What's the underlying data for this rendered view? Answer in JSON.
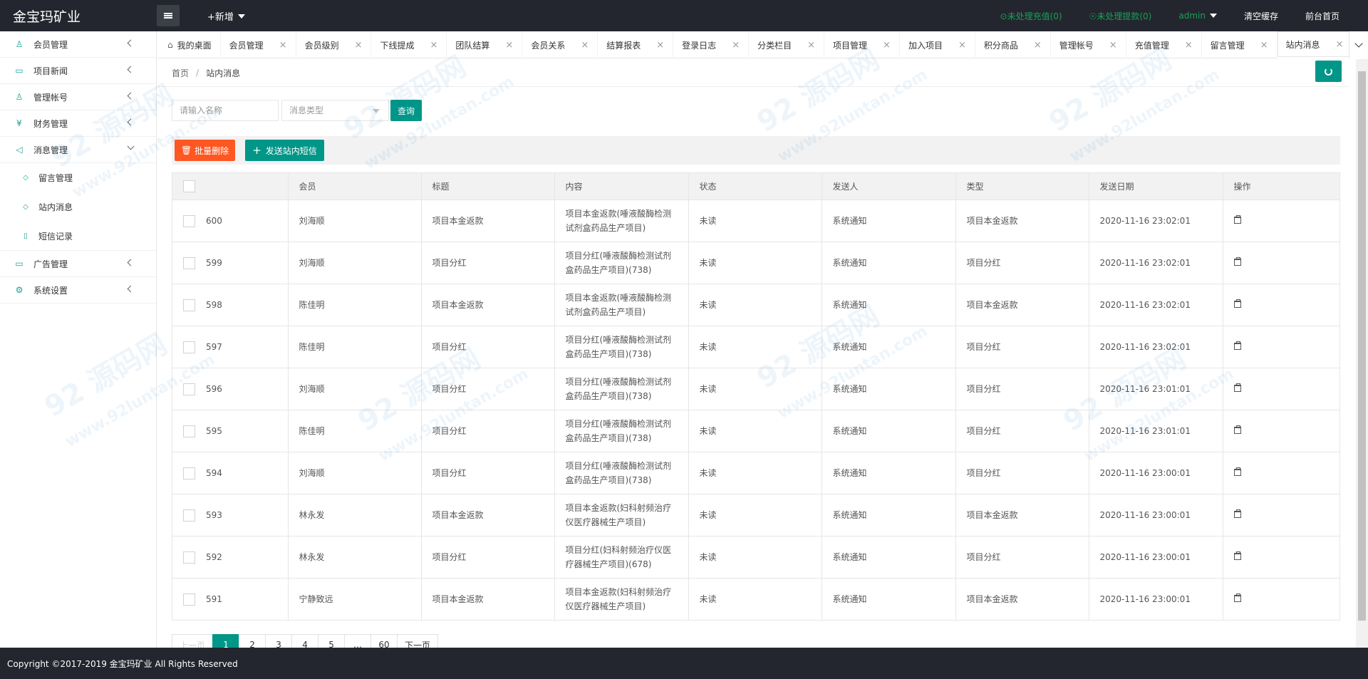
{
  "header": {
    "logo": "金宝玛矿业",
    "new_label": "+新增",
    "pending_recharge": "⊙未处理充值(0)",
    "pending_withdraw": "☉未处理提款(0)",
    "admin": "admin",
    "clear_cache": "清空缓存",
    "frontend_home": "前台首页"
  },
  "sidebar": {
    "items": [
      {
        "label": "会员管理",
        "icon": "user-icon",
        "glyph": "♙"
      },
      {
        "label": "项目新闻",
        "icon": "book-icon",
        "glyph": "▭"
      },
      {
        "label": "管理帐号",
        "icon": "account-icon",
        "glyph": "♙"
      },
      {
        "label": "财务管理",
        "icon": "yen-icon",
        "glyph": "¥"
      },
      {
        "label": "消息管理",
        "icon": "message-icon",
        "glyph": "◁"
      }
    ],
    "sub_items": [
      {
        "label": "留言管理",
        "icon": "comment-icon",
        "glyph": "◇"
      },
      {
        "label": "站内消息",
        "icon": "chat-icon",
        "glyph": "◇"
      },
      {
        "label": "短信记录",
        "icon": "phone-icon",
        "glyph": "▯"
      }
    ],
    "items_after": [
      {
        "label": "广告管理",
        "icon": "image-icon",
        "glyph": "▭"
      },
      {
        "label": "系统设置",
        "icon": "gear-icon",
        "glyph": "⚙"
      }
    ]
  },
  "tabs": [
    "我的桌面",
    "会员管理",
    "会员级别",
    "下线提成",
    "团队结算",
    "会员关系",
    "结算报表",
    "登录日志",
    "分类栏目",
    "项目管理",
    "加入项目",
    "积分商品",
    "管理帐号",
    "充值管理",
    "留言管理",
    "站内消息"
  ],
  "breadcrumb": {
    "home": "首页",
    "sep": "/",
    "current": "站内消息"
  },
  "search": {
    "placeholder": "请输入名称",
    "type_placeholder": "消息类型",
    "button": "查询"
  },
  "toolbar": {
    "batch_delete": "批量删除",
    "send_message": "发送站内短信"
  },
  "table": {
    "columns": [
      "会员",
      "标题",
      "内容",
      "状态",
      "发送人",
      "类型",
      "发送日期",
      "操作"
    ],
    "rows": [
      {
        "id": "600",
        "member": "刘海顺",
        "title": "项目本金返款",
        "content1": "项目本金返款(唾液酸酶检测",
        "content2": "试剂盒药品生产项目)",
        "status": "未读",
        "sender": "系统通知",
        "type": "项目本金返款",
        "date": "2020-11-16 23:02:01"
      },
      {
        "id": "599",
        "member": "刘海顺",
        "title": "项目分红",
        "content1": "项目分红(唾液酸酶检测试剂",
        "content2": "盒药品生产项目)(738)",
        "status": "未读",
        "sender": "系统通知",
        "type": "项目分红",
        "date": "2020-11-16 23:02:01"
      },
      {
        "id": "598",
        "member": "陈佳明",
        "title": "项目本金返款",
        "content1": "项目本金返款(唾液酸酶检测",
        "content2": "试剂盒药品生产项目)",
        "status": "未读",
        "sender": "系统通知",
        "type": "项目本金返款",
        "date": "2020-11-16 23:02:01"
      },
      {
        "id": "597",
        "member": "陈佳明",
        "title": "项目分红",
        "content1": "项目分红(唾液酸酶检测试剂",
        "content2": "盒药品生产项目)(738)",
        "status": "未读",
        "sender": "系统通知",
        "type": "项目分红",
        "date": "2020-11-16 23:02:01"
      },
      {
        "id": "596",
        "member": "刘海顺",
        "title": "项目分红",
        "content1": "项目分红(唾液酸酶检测试剂",
        "content2": "盒药品生产项目)(738)",
        "status": "未读",
        "sender": "系统通知",
        "type": "项目分红",
        "date": "2020-11-16 23:01:01"
      },
      {
        "id": "595",
        "member": "陈佳明",
        "title": "项目分红",
        "content1": "项目分红(唾液酸酶检测试剂",
        "content2": "盒药品生产项目)(738)",
        "status": "未读",
        "sender": "系统通知",
        "type": "项目分红",
        "date": "2020-11-16 23:01:01"
      },
      {
        "id": "594",
        "member": "刘海顺",
        "title": "项目分红",
        "content1": "项目分红(唾液酸酶检测试剂",
        "content2": "盒药品生产项目)(738)",
        "status": "未读",
        "sender": "系统通知",
        "type": "项目分红",
        "date": "2020-11-16 23:00:01"
      },
      {
        "id": "593",
        "member": "林永发",
        "title": "项目本金返款",
        "content1": "项目本金返款(妇科射频治疗",
        "content2": "仪医疗器械生产项目)",
        "status": "未读",
        "sender": "系统通知",
        "type": "项目本金返款",
        "date": "2020-11-16 23:00:01"
      },
      {
        "id": "592",
        "member": "林永发",
        "title": "项目分红",
        "content1": "项目分红(妇科射频治疗仪医",
        "content2": "疗器械生产项目)(678)",
        "status": "未读",
        "sender": "系统通知",
        "type": "项目分红",
        "date": "2020-11-16 23:00:01"
      },
      {
        "id": "591",
        "member": "宁静致远",
        "title": "项目本金返款",
        "content1": "项目本金返款(妇科射频治疗",
        "content2": "仪医疗器械生产项目)",
        "status": "未读",
        "sender": "系统通知",
        "type": "项目本金返款",
        "date": "2020-11-16 23:00:01"
      }
    ]
  },
  "pagination": {
    "prev": "上一页",
    "pages": [
      "1",
      "2",
      "3",
      "4",
      "5",
      "…",
      "60"
    ],
    "next": "下一页",
    "current": "1"
  },
  "footer": {
    "copyright": "Copyright ©2017-2019 金宝玛矿业 All Rights Reserved"
  },
  "watermark": {
    "text": "92 源码网",
    "url": "www.92luntan.com"
  },
  "colors": {
    "accent": "#009688",
    "danger": "#ff5722",
    "header": "#23262e",
    "status_green": "#1aa058"
  }
}
